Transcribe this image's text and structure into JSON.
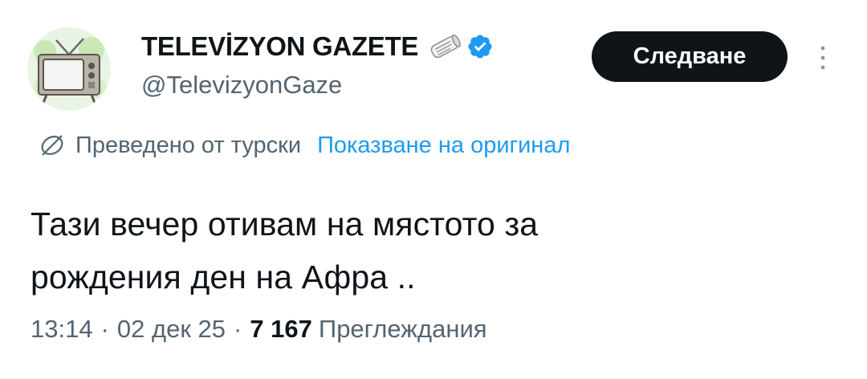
{
  "author": {
    "display_name": "TELEVİZYON GAZETE",
    "handle": "@TelevizyonGaze",
    "name_emoji_icon": "newspaper-icon",
    "verified_icon": "verified-badge-icon",
    "avatar_icon": "retro-tv-icon"
  },
  "actions": {
    "follow_label": "Следване",
    "more_icon": "more-vertical-icon"
  },
  "translation": {
    "icon": "translate-globe-icon",
    "label": "Преведено от турски",
    "show_original": "Показване на оригинал"
  },
  "tweet": {
    "line1": "Тази вечер отивам на мястото за",
    "line2": "рождения ден на Афра .."
  },
  "meta": {
    "time": "13:14",
    "date": "02 дек 25",
    "views_count": "7 167",
    "views_label": "Преглеждания",
    "separator": "·"
  },
  "colors": {
    "text_primary": "#0f1419",
    "text_secondary": "#536471",
    "link": "#1d9bf0",
    "verified": "#1d9bf0",
    "follow_bg": "#0f1419"
  }
}
